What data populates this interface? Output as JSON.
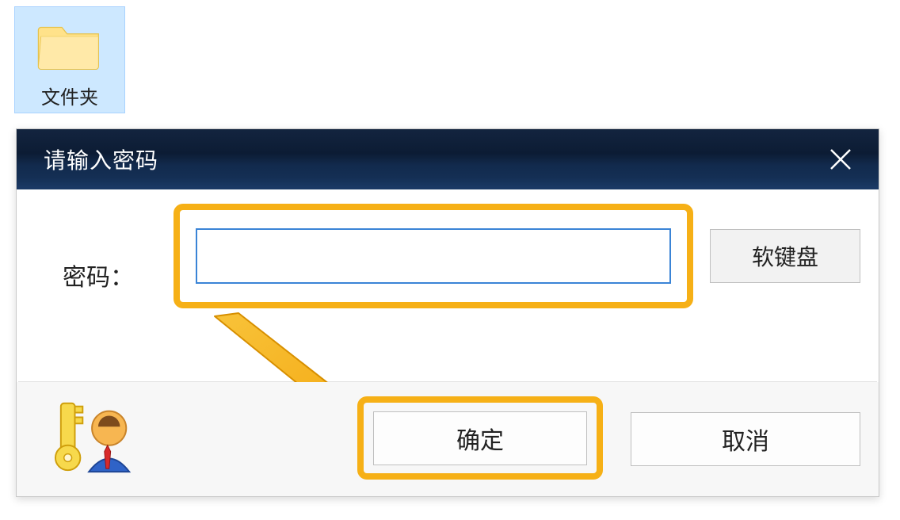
{
  "desktop": {
    "folder_label": "文件夹"
  },
  "dialog": {
    "title": "请输入密码",
    "password_label": "密码：",
    "password_value": "",
    "soft_keyboard_label": "软键盘",
    "ok_label": "确定",
    "cancel_label": "取消"
  },
  "annotations": {
    "highlight_color": "#f6b016",
    "arrow_color": "#f6b016"
  }
}
